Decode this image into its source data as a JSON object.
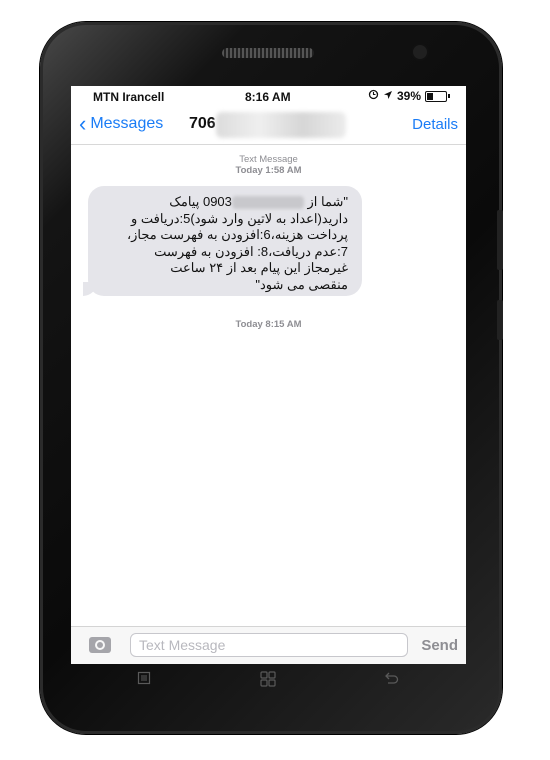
{
  "status_bar": {
    "carrier": "MTN Irancell",
    "time": "8:16 AM",
    "battery": "39%",
    "battery_level": 0.39
  },
  "nav": {
    "back_label": "Messages",
    "title": "706",
    "details_label": "Details"
  },
  "thread": {
    "meta_1_label": "Text Message",
    "meta_1_time": "Today 1:58 AM",
    "message_prefix": "\"شما از ",
    "message_number": "0903",
    "message_body": " پیامک\nدارید(اعداد به لاتین وارد شود)5:دریافت و\nپرداخت هزینه،6:افزودن به فهرست مجاز،\n7:عدم دریافت،8: افزودن به فهرست\nغیرمجاز این پیام بعد از ۲۴ ساعت\nمنقصی می شود\"",
    "meta_2": "Today 8:15 AM"
  },
  "input_bar": {
    "placeholder": "Text Message",
    "send_label": "Send"
  },
  "colors": {
    "accent": "#1a7cf6",
    "bubble": "#e5e5ea",
    "meta_text": "#8e8e93"
  },
  "icons": {
    "back": "chevron-left-icon",
    "camera": "camera-icon",
    "location": "location-arrow-icon",
    "alarm": "alarm-icon",
    "battery": "battery-icon",
    "menu": "menu-icon",
    "home": "home-icon",
    "back_softkey": "back-arrow-icon"
  }
}
